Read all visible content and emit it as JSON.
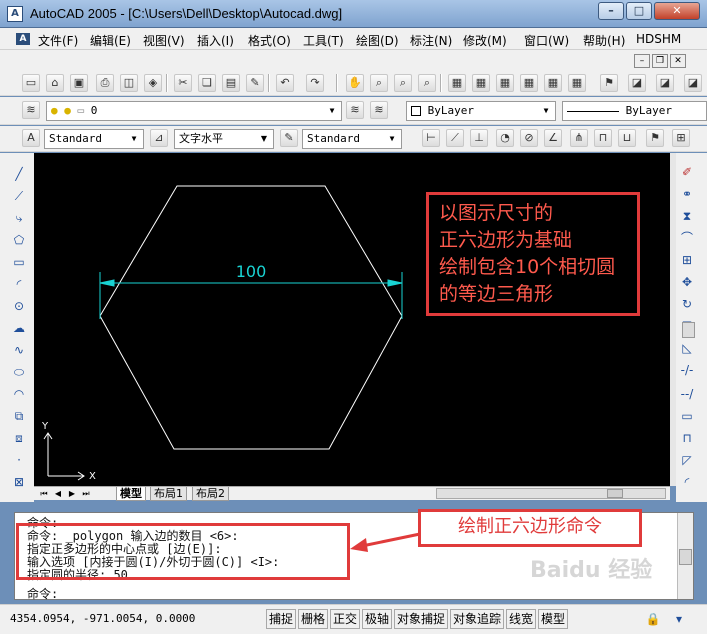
{
  "window": {
    "title": "AutoCAD 2005 - [C:\\Users\\Dell\\Desktop\\Autocad.dwg]"
  },
  "menu": [
    "文件(F)",
    "编辑(E)",
    "视图(V)",
    "插入(I)",
    "格式(O)",
    "工具(T)",
    "绘图(D)",
    "标注(N)",
    "修改(M)",
    "窗口(W)",
    "帮助(H)",
    "HDSHM"
  ],
  "layers": {
    "current": "0",
    "color": "ByLayer",
    "linetype": "ByLayer"
  },
  "styles": {
    "text_style": "Standard",
    "text_mode": "文字水平",
    "dim_style": "Standard"
  },
  "drawing": {
    "dimension": "100",
    "ucs_y": "Y",
    "ucs_x": "X",
    "polygon_sides": 6,
    "radius": 50
  },
  "annotation": {
    "lines": [
      "以图示尺寸的",
      "正六边形为基础",
      "绘制包含10个相切圆",
      "的等边三角形"
    ],
    "callout": "绘制正六边形命令"
  },
  "tabs": [
    "模型",
    "布局1",
    "布局2"
  ],
  "command": {
    "lines": [
      "命令:",
      "命令: _polygon 输入边的数目 <6>:",
      "指定正多边形的中心点或 [边(E)]:",
      "输入选项 [内接于圆(I)/外切于圆(C)] <I>:",
      "指定圆的半径: 50",
      "命令:"
    ]
  },
  "status": {
    "coords": "4354.0954, -971.0054, 0.0000",
    "buttons": [
      "捕捉",
      "栅格",
      "正交",
      "极轴",
      "对象捕捉",
      "对象追踪",
      "线宽",
      "模型"
    ]
  },
  "colors": {
    "dimension": "#19d3d3",
    "annotation": "#e03b3b",
    "background": "#000000"
  },
  "watermark": "Baidu 经验"
}
